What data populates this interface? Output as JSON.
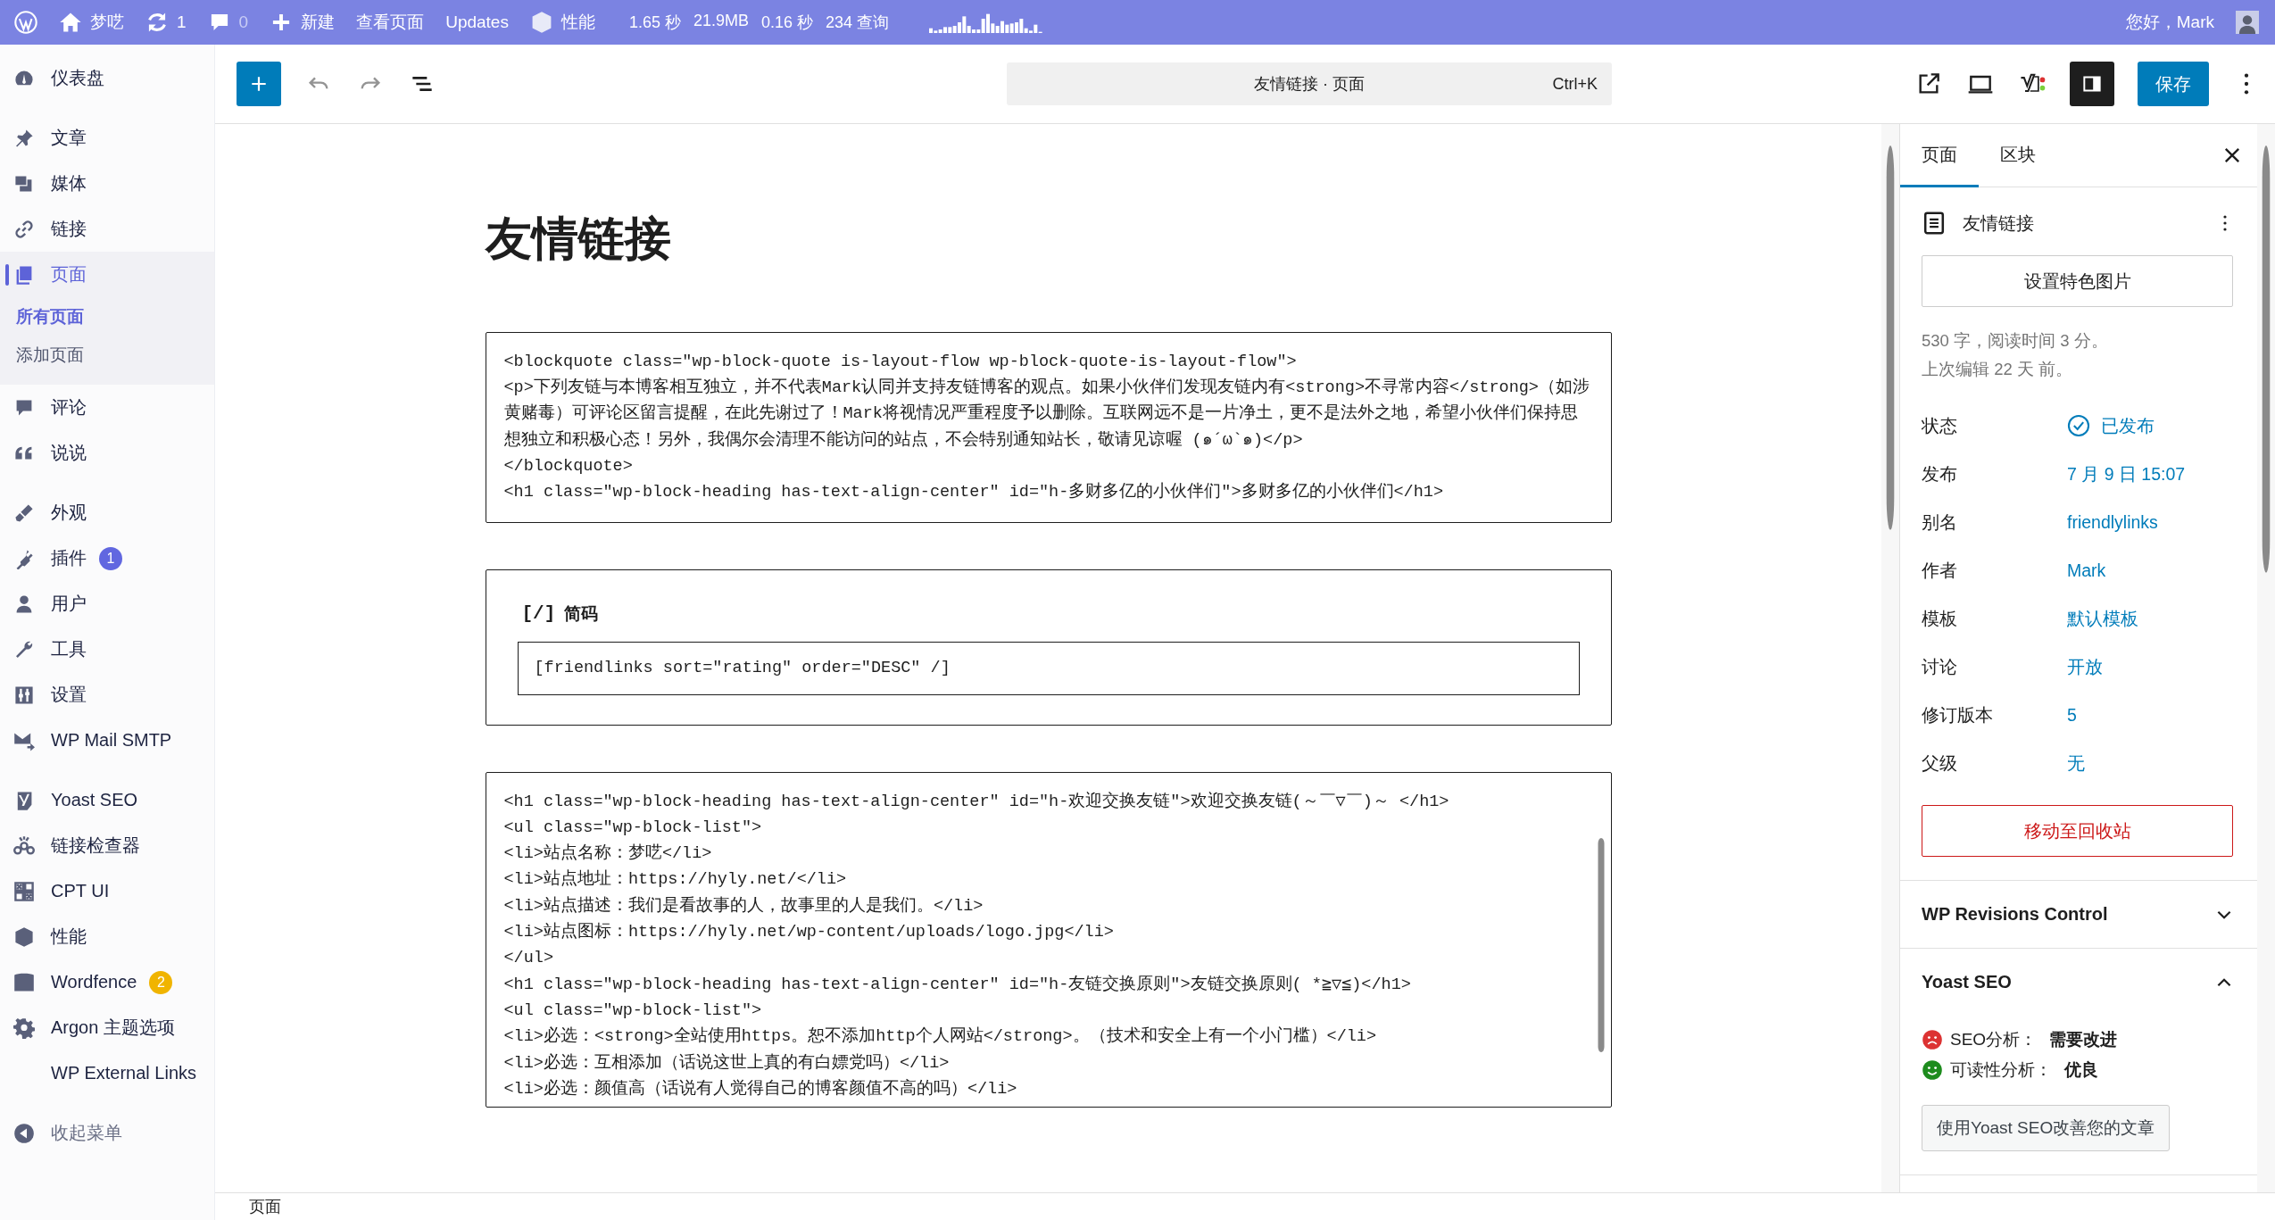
{
  "admin_bar": {
    "site": "梦呓",
    "updates": "1",
    "comments": "0",
    "new": "新建",
    "view_page": "查看页面",
    "updates_link": "Updates",
    "perf": "性能",
    "stats": [
      "1.65 秒",
      "21.9MB",
      "0.16 秒",
      "234 查询"
    ],
    "greeting": "您好，Mark"
  },
  "sidebar": {
    "groups": [
      [
        {
          "label": "仪表盘",
          "selected": false
        }
      ],
      [
        {
          "label": "文章",
          "selected": false
        },
        {
          "label": "媒体",
          "selected": false
        },
        {
          "label": "链接",
          "selected": false
        },
        {
          "label": "页面",
          "selected": true,
          "children": [
            {
              "label": "所有页面",
              "selected": true
            },
            {
              "label": "添加页面",
              "selected": false
            }
          ]
        },
        {
          "label": "评论",
          "selected": false
        },
        {
          "label": "说说",
          "selected": false
        }
      ],
      [
        {
          "label": "外观",
          "selected": false
        },
        {
          "label": "插件",
          "selected": false,
          "badge": {
            "text": "1",
            "color": "#6167e0"
          }
        },
        {
          "label": "用户",
          "selected": false
        },
        {
          "label": "工具",
          "selected": false
        },
        {
          "label": "设置",
          "selected": false
        },
        {
          "label": "WP Mail SMTP",
          "selected": false
        }
      ],
      [
        {
          "label": "Yoast SEO",
          "selected": false
        },
        {
          "label": "链接检查器",
          "selected": false
        },
        {
          "label": "CPT UI",
          "selected": false
        },
        {
          "label": "性能",
          "selected": false
        },
        {
          "label": "Wordfence",
          "selected": false,
          "badge": {
            "text": "2",
            "color": "#f0b400"
          }
        },
        {
          "label": "Argon 主题选项",
          "selected": false
        },
        {
          "label": "WP External Links",
          "selected": false
        }
      ]
    ],
    "collapse": "收起菜单"
  },
  "editor": {
    "command_title": "友情链接 · 页面",
    "shortcut": "Ctrl+K",
    "sidebar_toggle_on": true,
    "save": "保存"
  },
  "canvas": {
    "title": "友情链接",
    "blocks": [
      {
        "kind": "html",
        "lines": [
          "<blockquote class=\"wp-block-quote is-layout-flow wp-block-quote-is-layout-flow\">",
          "<p>下列友链与本博客相互独立，并不代表Mark认同并支持友链博客的观点。如果小伙伴们发现友链内有<strong>不寻常内容</strong>（如涉黄赌毒）可评论区留言提醒，在此先谢过了！Mark将视情况严重程度予以删除。互联网远不是一片净土，更不是法外之地，希望小伙伴们保持思想独立和积极心态！另外，我偶尔会清理不能访问的站点，不会特别通知站长，敬请见谅喔 (๑´ω`๑)</p>",
          "</blockquote>",
          "<h1 class=\"wp-block-heading has-text-align-center\" id=\"h-多财多亿的小伙伴们\">多财多亿的小伙伴们</h1>"
        ]
      },
      {
        "kind": "shortcode",
        "label_mark": "[/]",
        "label": "简码",
        "value": "[friendlinks sort=\"rating\" order=\"DESC\" /]"
      },
      {
        "kind": "html",
        "lines": [
          "<h1 class=\"wp-block-heading has-text-align-center\" id=\"h-欢迎交换友链\">欢迎交换友链(～￣▽￣)～ </h1>",
          "<ul class=\"wp-block-list\">",
          "<li>站点名称：梦呓</li>",
          "<li>站点地址：https://hyly.net/</li>",
          "<li>站点描述：我们是看故事的人，故事里的人是我们。</li>",
          "<li>站点图标：https://hyly.net/wp-content/uploads/logo.jpg</li>",
          "</ul>",
          "<h1 class=\"wp-block-heading has-text-align-center\" id=\"h-友链交换原则\">友链交换原则( *≧▽≦)</h1>",
          "<ul class=\"wp-block-list\">",
          "<li>必选：<strong>全站使用https。恕不添加http个人网站</strong>。（技术和安全上有一个小门槛）</li>",
          "<li>必选：互相添加（话说这世上真的有白嫖党吗）</li>",
          "<li>必选：颜值高（话说有人觉得自己的博客颜值不高的吗）</li>"
        ]
      }
    ]
  },
  "panel": {
    "tabs": [
      {
        "label": "页面",
        "selected": true
      },
      {
        "label": "区块",
        "selected": false
      }
    ],
    "doc_title": "友情链接",
    "featured_button": "设置特色图片",
    "info": [
      "530 字，阅读时间 3 分。",
      "上次编辑 22 天 前。"
    ],
    "rows": [
      {
        "kind": "status",
        "label": "状态",
        "value": "已发布"
      },
      {
        "kind": "link",
        "label": "发布",
        "value": "7 月 9 日 15:07"
      },
      {
        "kind": "link",
        "label": "别名",
        "value": "friendlylinks"
      },
      {
        "kind": "link",
        "label": "作者",
        "value": "Mark"
      },
      {
        "kind": "link",
        "label": "模板",
        "value": "默认模板"
      },
      {
        "kind": "link",
        "label": "讨论",
        "value": "开放"
      },
      {
        "kind": "link",
        "label": "修订版本",
        "value": "5"
      },
      {
        "kind": "link",
        "label": "父级",
        "value": "无"
      }
    ],
    "trash": "移动至回收站",
    "sections": [
      {
        "title": "WP Revisions Control",
        "expanded": false
      },
      {
        "title": "Yoast SEO",
        "expanded": true,
        "analyses": [
          {
            "label": "SEO分析：",
            "result": "需要改进",
            "kind": "bad"
          },
          {
            "label": "可读性分析：",
            "result": "优良",
            "kind": "good"
          }
        ],
        "button": "使用Yoast SEO改善您的文章"
      }
    ]
  },
  "footer": {
    "breadcrumb": "页面"
  }
}
